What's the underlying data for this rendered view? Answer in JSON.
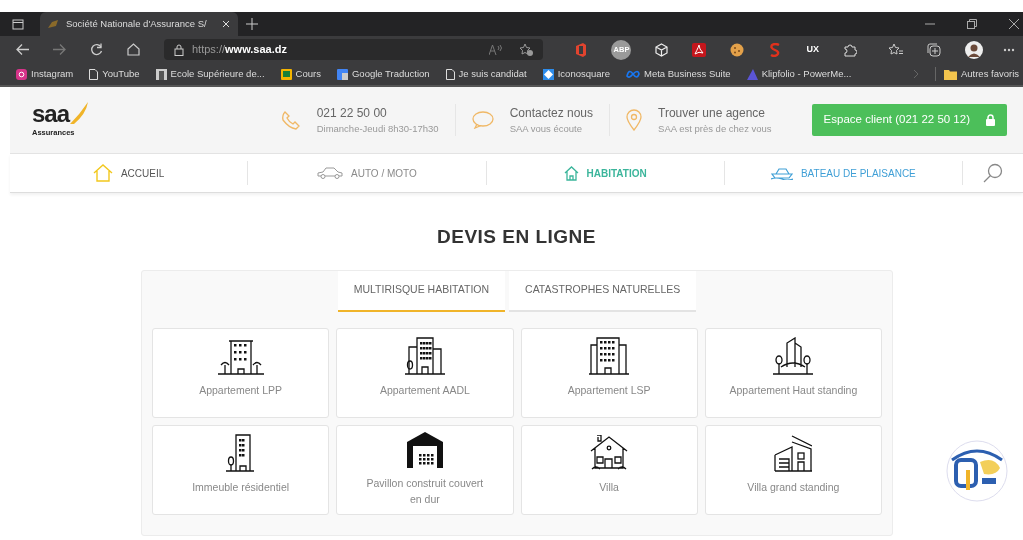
{
  "browser": {
    "tab_title": "Société Nationale d'Assurance S/",
    "url": "https://**www.saa.dz**",
    "extension_badges": [
      "ABP",
      "UX"
    ],
    "bookmarks": [
      "Instagram",
      "YouTube",
      "Ecole Supérieure de...",
      "Cours",
      "Google Traduction",
      "Je suis candidat",
      "Iconosquare",
      "Meta Business Suite",
      "Klipfolio - PowerMe..."
    ],
    "other_bookmarks": "Autres favoris"
  },
  "header": {
    "contacts": [
      {
        "title": "021 22 50 00",
        "subtitle": "Dimanche-Jeudi 8h30-17h30"
      },
      {
        "title": "Contactez nous",
        "subtitle": "SAA vous écoute"
      },
      {
        "title": "Trouver une agence",
        "subtitle": "SAA est près de chez vous"
      }
    ],
    "client_button": "Espace client (021 22 50 12)",
    "logo_text": "saa",
    "logo_subtext": "Assurances"
  },
  "nav": [
    {
      "label": "ACCUEIL",
      "selected": false,
      "color": "#555555"
    },
    {
      "label": "AUTO / MOTO",
      "selected": false,
      "color": "#8a8a8a"
    },
    {
      "label": "HABITATION",
      "selected": true,
      "color": "#3bb59b"
    },
    {
      "label": "BATEAU DE PLAISANCE",
      "selected": false,
      "color": "#3f9fd6"
    }
  ],
  "heading": "DEVIS EN LIGNE",
  "tabs": [
    {
      "label": "MULTIRISQUE HABITATION",
      "selected": true
    },
    {
      "label": "CATASTROPHES NATURELLES",
      "selected": false
    }
  ],
  "products": [
    {
      "label": "Appartement LPP"
    },
    {
      "label": "Appartement AADL"
    },
    {
      "label": "Appartement LSP"
    },
    {
      "label": "Appartement Haut standing"
    },
    {
      "label": "Immeuble résidentiel"
    },
    {
      "label": "Pavillon construit couvert en dur"
    },
    {
      "label": "Villa"
    },
    {
      "label": "Villa grand standing"
    }
  ]
}
